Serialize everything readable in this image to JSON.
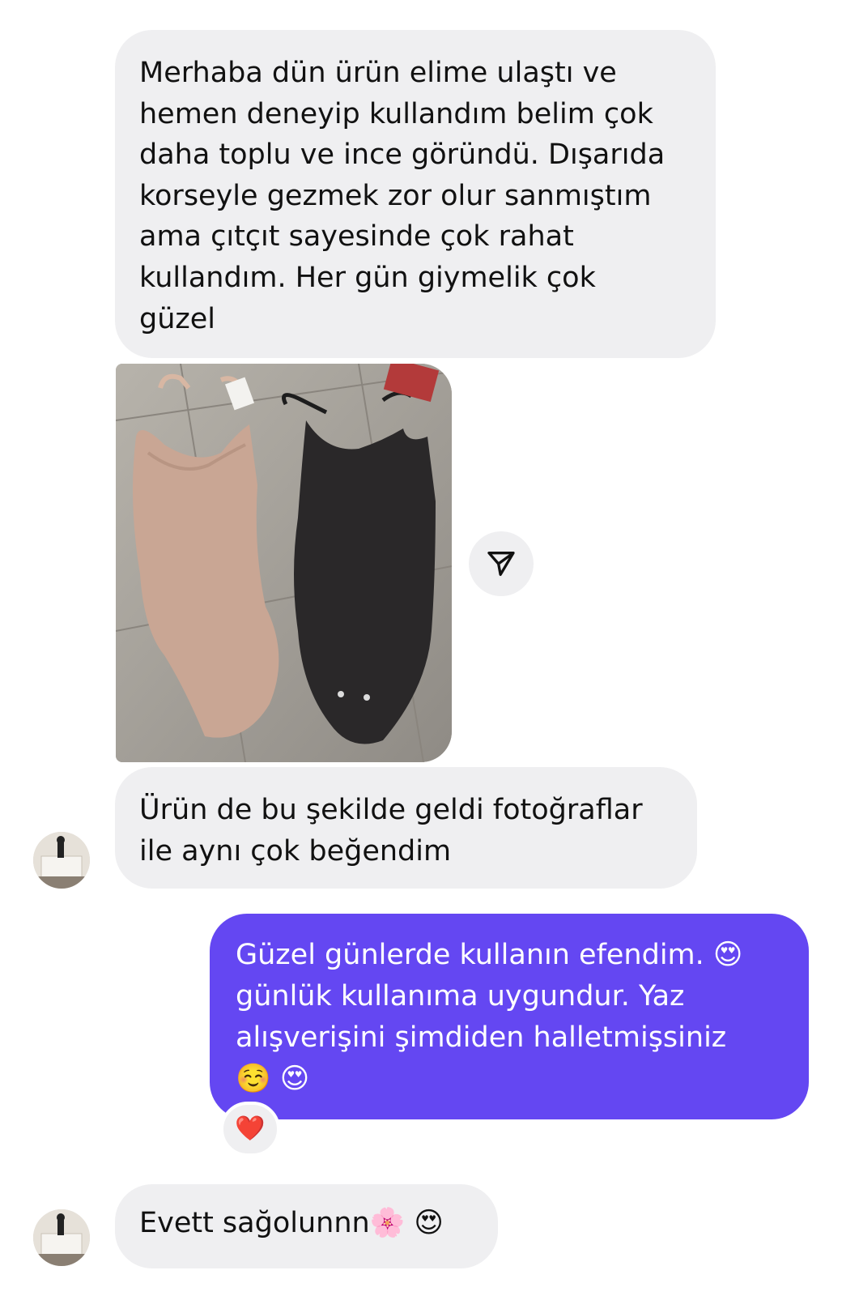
{
  "messages": {
    "m1": "Merhaba dün ürün elime ulaştı ve\nhemen deneyip kullandım belim çok\ndaha toplu ve ince göründü. Dışarıda\nkorseyle gezmek zor olur sanmıştım\nama çıtçıt sayesinde çok rahat\nkullandım. Her gün giymelik çok\ngüzel",
    "m2": "Ürün de bu şekilde geldi fotoğraflar\nile aynı çok beğendim",
    "m3": "Güzel günlerde kullanın efendim. 😍\ngünlük kullanıma uygundur. Yaz\nalışverişini şimdiden halletmişsiniz\n☺️ 😍",
    "m4": "Evett sağolunnn🌸 😍"
  },
  "reaction": {
    "emoji": "❤️"
  },
  "icons": {
    "share": "send-icon",
    "avatar": "avatar-photo",
    "photo": "bodysuit-photo"
  },
  "colors": {
    "incoming_bubble": "#efeff1",
    "outgoing_bubble": "#6447f2",
    "text_dark": "#111111",
    "text_light": "#ffffff"
  }
}
